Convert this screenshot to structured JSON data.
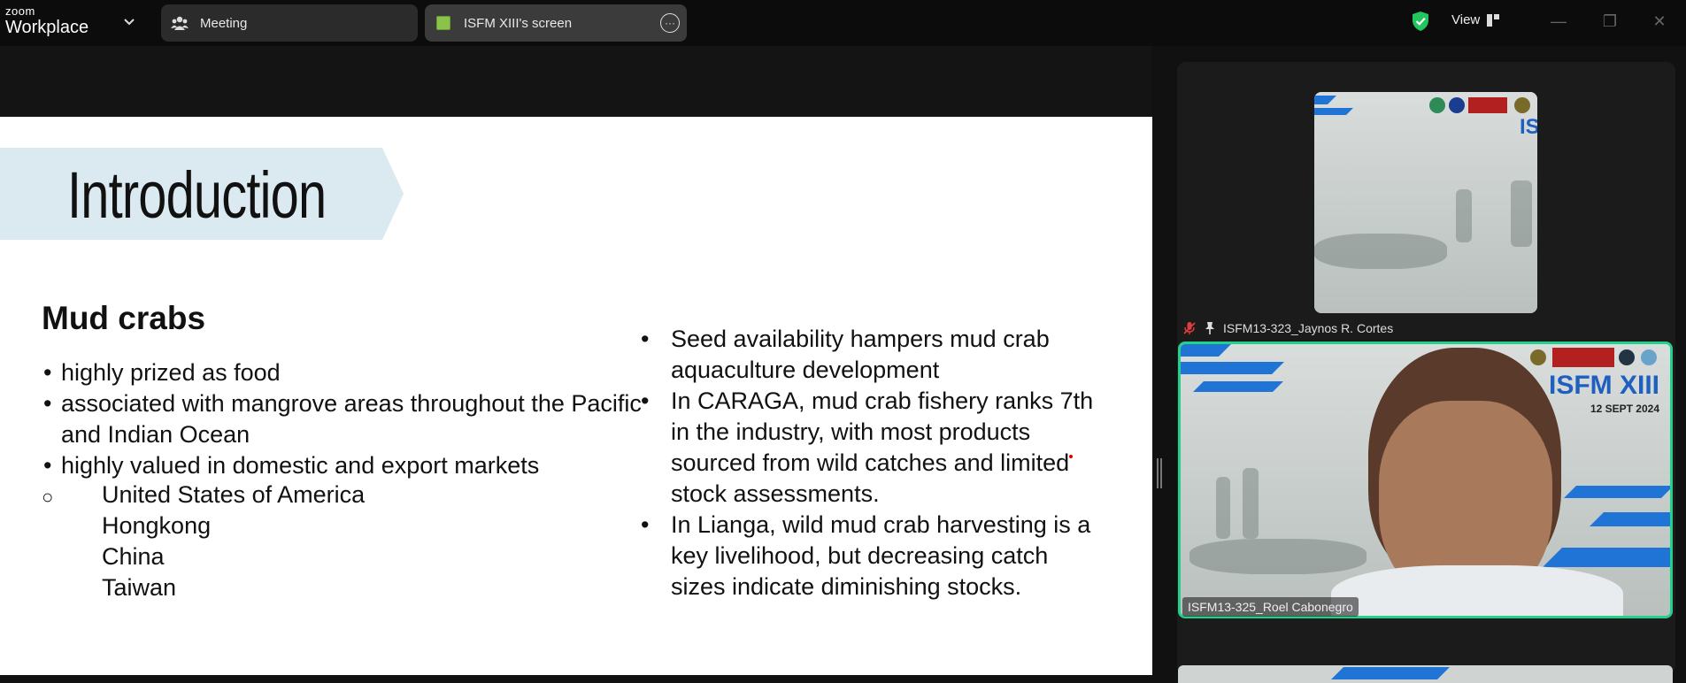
{
  "app": {
    "brand_small": "zoom",
    "brand_big": "Workplace"
  },
  "tabs": [
    {
      "label": "Meeting",
      "icon": "participants-icon"
    },
    {
      "label": "ISFM XIII's screen",
      "icon": "shared-screen-icon"
    }
  ],
  "toolbar": {
    "view_label": "View",
    "security_color": "#23c55e"
  },
  "slide": {
    "title": "Introduction",
    "heading": "Mud crabs",
    "left_bullets": [
      "highly prized as food",
      "associated with mangrove areas throughout the Pacific and Indian Ocean",
      "highly valued in domestic and export markets"
    ],
    "countries": [
      "United States of America",
      "Hongkong",
      "China",
      "Taiwan"
    ],
    "right_bullets": [
      "Seed availability hampers mud crab aquaculture development",
      "In CARAGA, mud crab fishery ranks 7th in the industry, with most products sourced from wild catches and limited stock assessments.",
      "In Lianga, wild mud crab harvesting is a key livelihood, but decreasing catch sizes indicate diminishing stocks."
    ],
    "bullet_char": "•",
    "sub_bullet_char": "○"
  },
  "participants": [
    {
      "name": "ISFM13-323_Jaynos R. Cortes",
      "muted": true,
      "pinned": true
    },
    {
      "name": "ISFM13-325_Roel Cabonegro",
      "active_speaker": true,
      "banner_title": "ISFM XIII",
      "banner_date": "12 SEPT 2024"
    }
  ],
  "colors": {
    "accent_green": "#23d18b",
    "banner_blue": "#1f74d6",
    "intro_band": "#dbe9f1"
  }
}
